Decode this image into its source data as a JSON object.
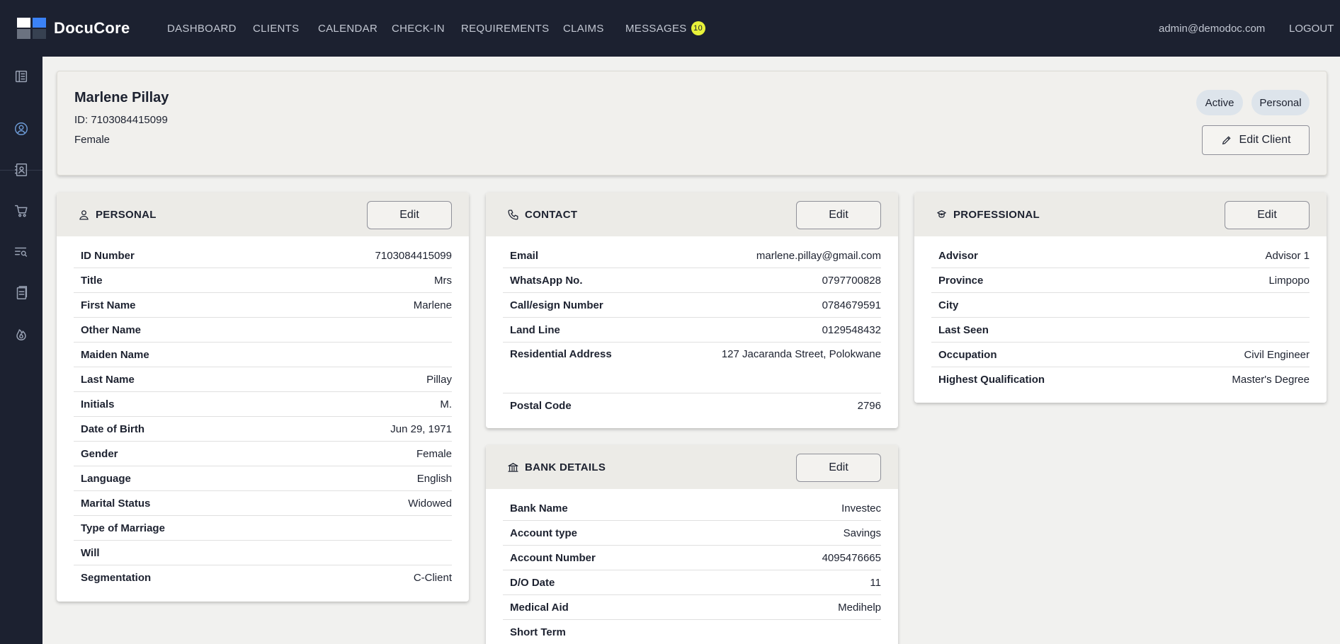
{
  "app": {
    "name": "DocuCore"
  },
  "nav": [
    {
      "label": "DASHBOARD"
    },
    {
      "label": "CLIENTS"
    },
    {
      "label": "CALENDAR"
    },
    {
      "label": "CHECK-IN"
    },
    {
      "label": "REQUIREMENTS"
    },
    {
      "label": "CLAIMS"
    },
    {
      "label": "MESSAGES",
      "badge": "10"
    }
  ],
  "user": {
    "email": "admin@demodoc.com",
    "logout": "LOGOUT"
  },
  "sidebar_icons": [
    "panel-icon",
    "user-circle-icon",
    "contacts-icon",
    "cart-icon",
    "search-list-icon",
    "documents-icon",
    "flame-icon"
  ],
  "client": {
    "name": "Marlene Pillay",
    "id_line": "ID: 7103084415099",
    "gender": "Female",
    "status": "Active",
    "type": "Personal",
    "edit_label": "Edit Client"
  },
  "personal": {
    "title": "PERSONAL",
    "edit": "Edit",
    "rows": [
      {
        "label": "ID Number",
        "value": "7103084415099"
      },
      {
        "label": "Title",
        "value": "Mrs"
      },
      {
        "label": "First Name",
        "value": "Marlene"
      },
      {
        "label": "Other Name",
        "value": ""
      },
      {
        "label": "Maiden Name",
        "value": ""
      },
      {
        "label": "Last Name",
        "value": "Pillay"
      },
      {
        "label": "Initials",
        "value": "M."
      },
      {
        "label": "Date of Birth",
        "value": "Jun 29, 1971"
      },
      {
        "label": "Gender",
        "value": "Female"
      },
      {
        "label": "Language",
        "value": "English"
      },
      {
        "label": "Marital Status",
        "value": "Widowed"
      },
      {
        "label": "Type of Marriage",
        "value": ""
      },
      {
        "label": "Will",
        "value": ""
      },
      {
        "label": "Segmentation",
        "value": "C-Client"
      }
    ]
  },
  "contact": {
    "title": "CONTACT",
    "edit": "Edit",
    "rows": [
      {
        "label": "Email",
        "value": "marlene.pillay@gmail.com"
      },
      {
        "label": "WhatsApp No.",
        "value": "0797700828"
      },
      {
        "label": "Call/esign Number",
        "value": "0784679591"
      },
      {
        "label": "Land Line",
        "value": "0129548432"
      },
      {
        "label": "Residential Address",
        "value": "127 Jacaranda Street, Polokwane"
      },
      {
        "label": "Postal Code",
        "value": "2796"
      }
    ]
  },
  "professional": {
    "title": "PROFESSIONAL",
    "edit": "Edit",
    "rows": [
      {
        "label": "Advisor",
        "value": "Advisor 1"
      },
      {
        "label": "Province",
        "value": "Limpopo"
      },
      {
        "label": "City",
        "value": ""
      },
      {
        "label": "Last Seen",
        "value": ""
      },
      {
        "label": "Occupation",
        "value": "Civil Engineer"
      },
      {
        "label": "Highest Qualification",
        "value": "Master's Degree"
      }
    ]
  },
  "bank": {
    "title": "BANK DETAILS",
    "edit": "Edit",
    "rows": [
      {
        "label": "Bank Name",
        "value": "Investec"
      },
      {
        "label": "Account type",
        "value": "Savings"
      },
      {
        "label": "Account Number",
        "value": "4095476665"
      },
      {
        "label": "D/O Date",
        "value": "11"
      },
      {
        "label": "Medical Aid",
        "value": "Medihelp"
      },
      {
        "label": "Short Term",
        "value": ""
      }
    ]
  }
}
